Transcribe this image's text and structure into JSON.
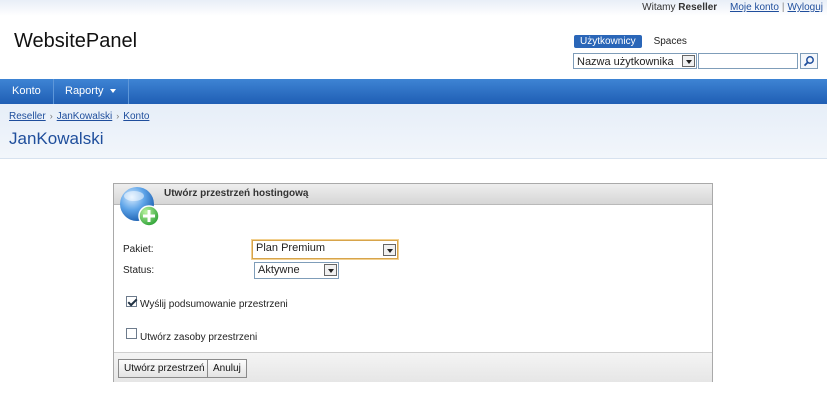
{
  "userbar": {
    "greeting": "Witamy",
    "username": "Reseller",
    "my_account": "Moje konto",
    "separator": "|",
    "logout": "Wyloguj"
  },
  "logo": "WebsitePanel",
  "search": {
    "tabs": [
      {
        "label": "Użytkownicy",
        "active": true
      },
      {
        "label": "Spaces",
        "active": false
      }
    ],
    "type_selected": "Nazwa użytkownika",
    "query": ""
  },
  "nav": {
    "items": [
      {
        "label": "Konto"
      },
      {
        "label": "Raporty",
        "has_dropdown": true
      }
    ]
  },
  "breadcrumb": [
    "Reseller",
    "JanKowalski",
    "Konto"
  ],
  "page_title": "JanKowalski",
  "panel": {
    "title": "Utwórz przestrzeń hostingową",
    "package_label": "Pakiet:",
    "package_value": "Plan Premium",
    "status_label": "Status:",
    "status_value": "Aktywne",
    "send_summary_label": "Wyślij podsumowanie przestrzeni",
    "send_summary_checked": true,
    "create_resources_label": "Utwórz zasoby przestrzeni",
    "create_resources_checked": false,
    "create_button": "Utwórz przestrzeń",
    "cancel_button": "Anuluj"
  },
  "colors": {
    "nav": "#2a6cc4",
    "link": "#1f4e9c",
    "accent": "#2a66b8"
  }
}
